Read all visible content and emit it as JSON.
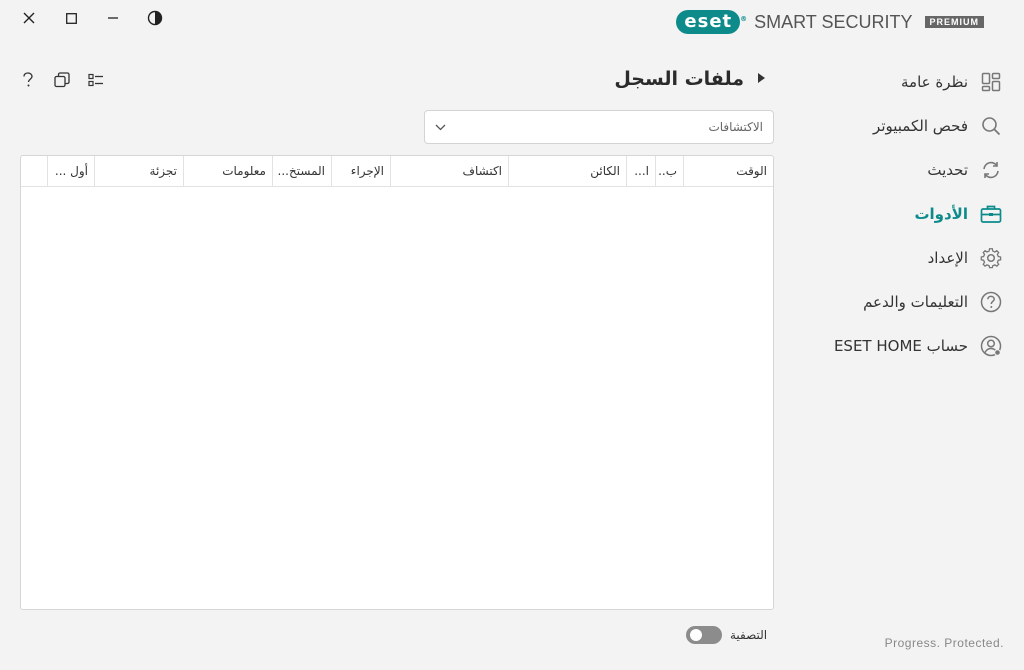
{
  "brand": {
    "logo": "eset",
    "product": "SMART SECURITY",
    "edition": "PREMIUM",
    "accent": "#0d8b8b"
  },
  "window_controls": [
    {
      "name": "close-button",
      "icon": "close-icon"
    },
    {
      "name": "maximize-button",
      "icon": "maximize-icon"
    },
    {
      "name": "minimize-button",
      "icon": "minimize-icon"
    },
    {
      "name": "theme-toggle-button",
      "icon": "contrast-icon"
    }
  ],
  "sidebar": {
    "items": [
      {
        "label": "نظرة عامة",
        "icon": "dashboard-icon",
        "active": false
      },
      {
        "label": "فحص الكمبيوتر",
        "icon": "search-icon",
        "active": false
      },
      {
        "label": "تحديث",
        "icon": "refresh-icon",
        "active": false
      },
      {
        "label": "الأدوات",
        "icon": "toolbox-icon",
        "active": true
      },
      {
        "label": "الإعداد",
        "icon": "gear-icon",
        "active": false
      },
      {
        "label": "التعليمات والدعم",
        "icon": "help-icon",
        "active": false
      },
      {
        "label": "حساب ESET HOME",
        "icon": "account-icon",
        "active": false
      }
    ]
  },
  "main": {
    "title": "ملفات السجل",
    "dropdown": {
      "selected": "الاكتشافات"
    },
    "table": {
      "columns": [
        "الوقت",
        "ب..",
        "ا...",
        "الكائن",
        "اكتشاف",
        "الإجراء",
        "المستخ...",
        "معلومات",
        "تجزئة",
        "أول ..."
      ],
      "rows": []
    },
    "filter": {
      "label": "التصفية",
      "enabled": false
    }
  },
  "status": {
    "tagline": "Progress. Protected."
  }
}
